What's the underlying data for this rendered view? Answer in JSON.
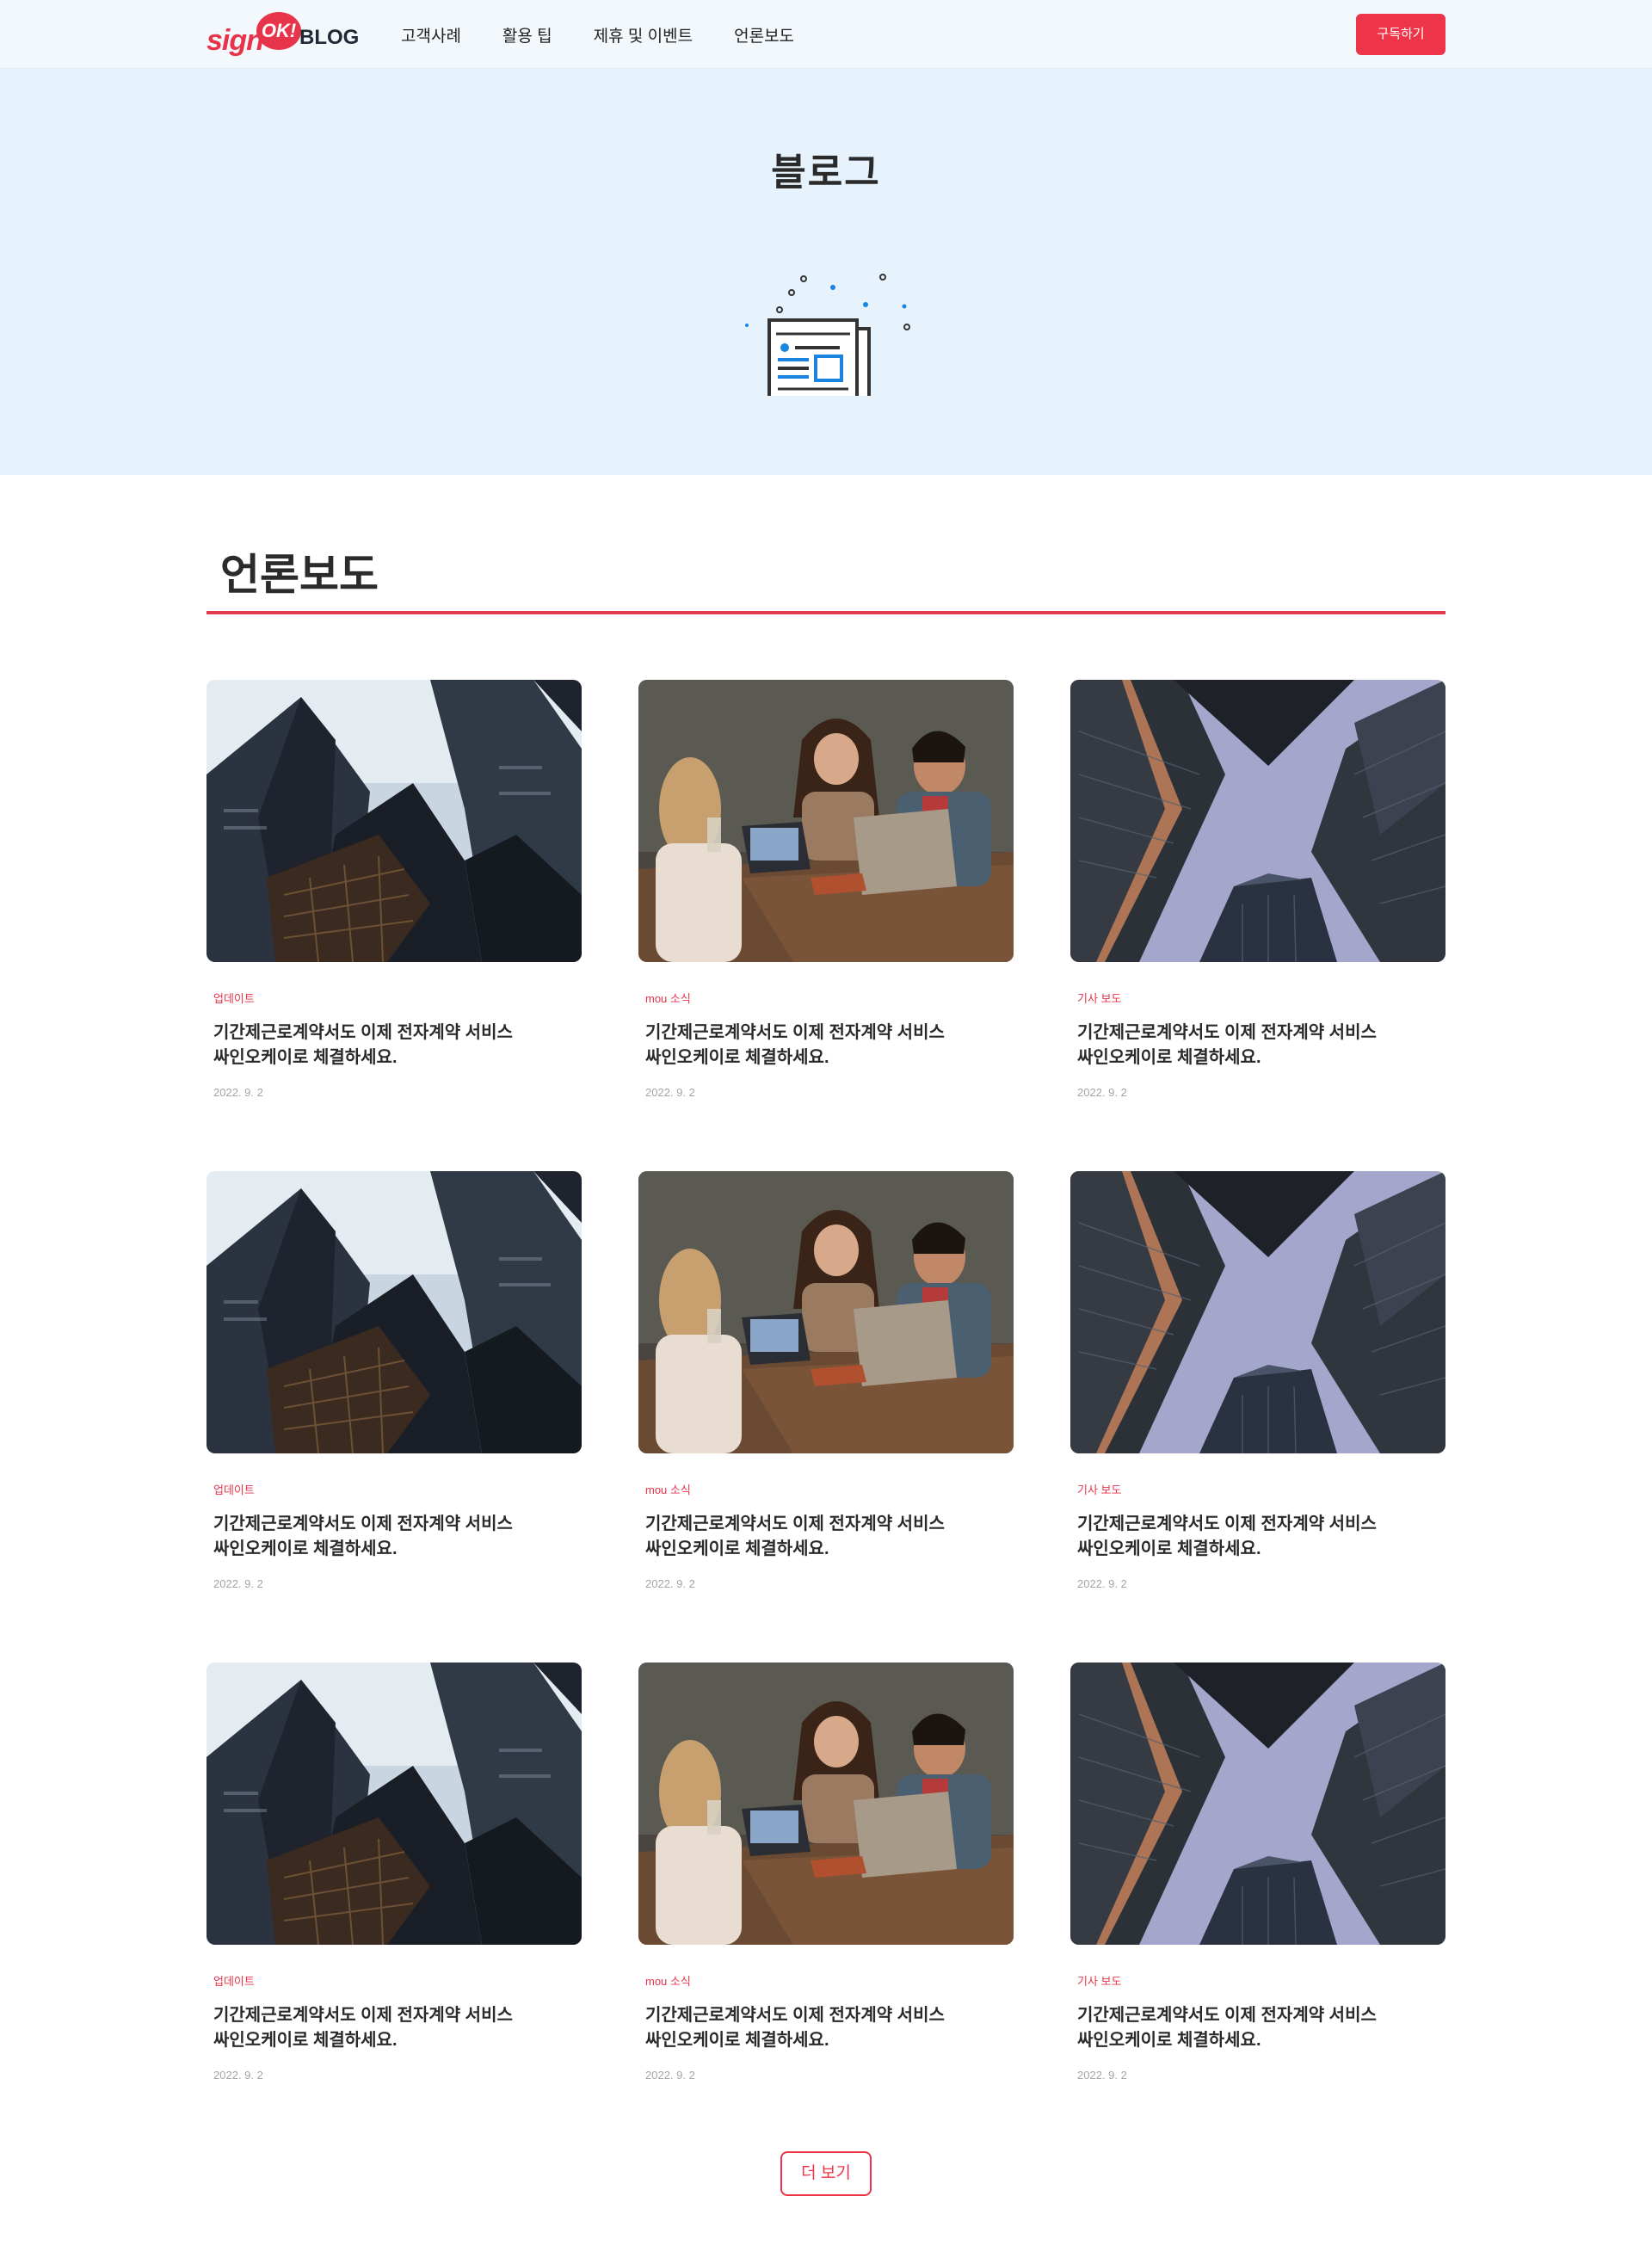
{
  "header": {
    "logo_sign": "sign",
    "logo_ok": "OK!",
    "logo_blog": "BLOG",
    "nav": [
      "고객사례",
      "활용 팁",
      "제휴 및 이벤트",
      "언론보도"
    ],
    "subscribe_label": "구독하기"
  },
  "hero": {
    "title": "블로그",
    "illustration": "newspaper-laptop-icon"
  },
  "section": {
    "title": "언론보도"
  },
  "cards": [
    {
      "image": "skyscrapers-photo",
      "category": "업데이트",
      "title_line1": "기간제근로계약서도 이제 전자계약 서비스",
      "title_line2": "싸인오케이로 체결하세요.",
      "date": "2022. 9. 2"
    },
    {
      "image": "people-meeting-photo",
      "category": "mou 소식",
      "title_line1": "기간제근로계약서도 이제 전자계약 서비스",
      "title_line2": "싸인오케이로 체결하세요.",
      "date": "2022. 9. 2"
    },
    {
      "image": "buildings-sky-photo",
      "category": "기사 보도",
      "title_line1": "기간제근로계약서도 이제 전자계약 서비스",
      "title_line2": "싸인오케이로 체결하세요.",
      "date": "2022. 9. 2"
    },
    {
      "image": "skyscrapers-photo",
      "category": "업데이트",
      "title_line1": "기간제근로계약서도 이제 전자계약 서비스",
      "title_line2": "싸인오케이로 체결하세요.",
      "date": "2022. 9. 2"
    },
    {
      "image": "people-meeting-photo",
      "category": "mou 소식",
      "title_line1": "기간제근로계약서도 이제 전자계약 서비스",
      "title_line2": "싸인오케이로 체결하세요.",
      "date": "2022. 9. 2"
    },
    {
      "image": "buildings-sky-photo",
      "category": "기사 보도",
      "title_line1": "기간제근로계약서도 이제 전자계약 서비스",
      "title_line2": "싸인오케이로 체결하세요.",
      "date": "2022. 9. 2"
    },
    {
      "image": "skyscrapers-photo",
      "category": "업데이트",
      "title_line1": "기간제근로계약서도 이제 전자계약 서비스",
      "title_line2": "싸인오케이로 체결하세요.",
      "date": "2022. 9. 2"
    },
    {
      "image": "people-meeting-photo",
      "category": "mou 소식",
      "title_line1": "기간제근로계약서도 이제 전자계약 서비스",
      "title_line2": "싸인오케이로 체결하세요.",
      "date": "2022. 9. 2"
    },
    {
      "image": "buildings-sky-photo",
      "category": "기사 보도",
      "title_line1": "기간제근로계약서도 이제 전자계약 서비스",
      "title_line2": "싸인오케이로 체결하세요.",
      "date": "2022. 9. 2"
    }
  ],
  "more_label": "더 보기",
  "colors": {
    "accent": "#ee3448",
    "header_bg": "#f3f8fd",
    "hero_bg": "#e6f2fc",
    "icon_blue": "#1a84e0"
  }
}
